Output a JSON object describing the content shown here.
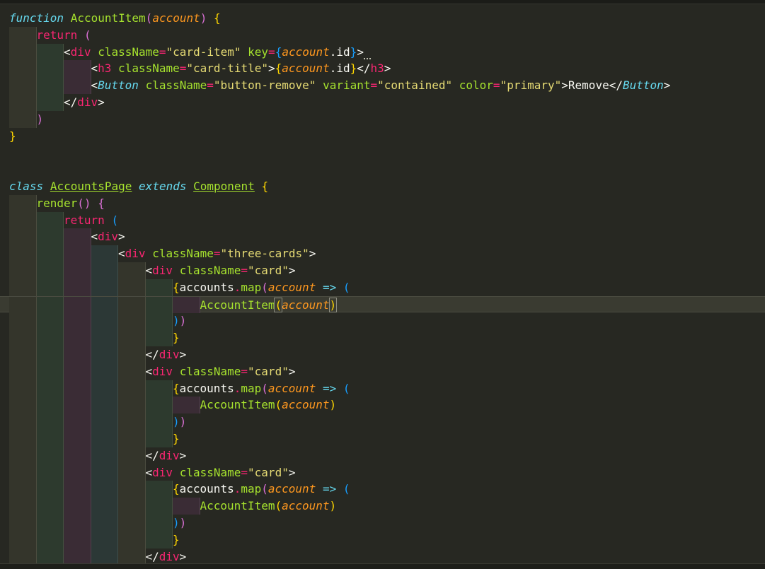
{
  "editor": {
    "lines": [
      {
        "indent": 0,
        "tokens": [
          {
            "c": "kw",
            "t": "function"
          },
          {
            "c": "plain",
            "t": " "
          },
          {
            "c": "fn",
            "t": "AccountItem"
          },
          {
            "c": "b2",
            "t": "("
          },
          {
            "c": "param",
            "t": "account"
          },
          {
            "c": "b2",
            "t": ")"
          },
          {
            "c": "plain",
            "t": " "
          },
          {
            "c": "b1",
            "t": "{"
          }
        ]
      },
      {
        "indent": 1,
        "tokens": [
          {
            "c": "ret",
            "t": "return"
          },
          {
            "c": "plain",
            "t": " "
          },
          {
            "c": "b2",
            "t": "("
          }
        ]
      },
      {
        "indent": 2,
        "tokens": [
          {
            "c": "punc",
            "t": "<"
          },
          {
            "c": "tag",
            "t": "div"
          },
          {
            "c": "plain",
            "t": " "
          },
          {
            "c": "attr",
            "t": "className"
          },
          {
            "c": "op",
            "t": "="
          },
          {
            "c": "str",
            "t": "\"card-item\""
          },
          {
            "c": "plain",
            "t": " "
          },
          {
            "c": "attr",
            "t": "key"
          },
          {
            "c": "op",
            "t": "="
          },
          {
            "c": "b3",
            "t": "{"
          },
          {
            "c": "param",
            "t": "account"
          },
          {
            "c": "plain",
            "t": ".id"
          },
          {
            "c": "b3",
            "t": "}"
          },
          {
            "c": "punc",
            "t": ">"
          }
        ]
      },
      {
        "indent": 3,
        "tokens": [
          {
            "c": "punc",
            "t": "<"
          },
          {
            "c": "tag",
            "t": "h3"
          },
          {
            "c": "plain",
            "t": " "
          },
          {
            "c": "attr",
            "t": "className"
          },
          {
            "c": "op",
            "t": "="
          },
          {
            "c": "str",
            "t": "\"card-title\""
          },
          {
            "c": "punc",
            "t": ">"
          },
          {
            "c": "b1",
            "t": "{"
          },
          {
            "c": "param",
            "t": "account"
          },
          {
            "c": "plain",
            "t": ".id"
          },
          {
            "c": "b1",
            "t": "}"
          },
          {
            "c": "punc",
            "t": "<"
          },
          {
            "c": "punc squiggle",
            "t": "/"
          },
          {
            "c": "tag",
            "t": "h3"
          },
          {
            "c": "punc",
            "t": ">"
          }
        ]
      },
      {
        "indent": 3,
        "tokens": [
          {
            "c": "punc",
            "t": "<"
          },
          {
            "c": "comp",
            "t": "Button"
          },
          {
            "c": "plain",
            "t": " "
          },
          {
            "c": "attr",
            "t": "className"
          },
          {
            "c": "op",
            "t": "="
          },
          {
            "c": "str",
            "t": "\"button-remove\""
          },
          {
            "c": "plain",
            "t": " "
          },
          {
            "c": "attr",
            "t": "variant"
          },
          {
            "c": "op",
            "t": "="
          },
          {
            "c": "str",
            "t": "\"contained\""
          },
          {
            "c": "plain",
            "t": " "
          },
          {
            "c": "attr",
            "t": "color"
          },
          {
            "c": "op",
            "t": "="
          },
          {
            "c": "str",
            "t": "\"primary\""
          },
          {
            "c": "punc",
            "t": ">"
          },
          {
            "c": "plain",
            "t": "Remove"
          },
          {
            "c": "punc",
            "t": "</"
          },
          {
            "c": "comp",
            "t": "Button"
          },
          {
            "c": "punc",
            "t": ">"
          }
        ]
      },
      {
        "indent": 2,
        "tokens": [
          {
            "c": "punc",
            "t": "</"
          },
          {
            "c": "tag",
            "t": "div"
          },
          {
            "c": "punc",
            "t": ">"
          }
        ]
      },
      {
        "indent": 1,
        "tokens": [
          {
            "c": "b2",
            "t": ")"
          }
        ]
      },
      {
        "indent": 0,
        "tokens": [
          {
            "c": "b1",
            "t": "}"
          }
        ]
      },
      {
        "indent": 0,
        "tokens": []
      },
      {
        "indent": 0,
        "tokens": []
      },
      {
        "indent": 0,
        "tokens": [
          {
            "c": "kw",
            "t": "class"
          },
          {
            "c": "plain",
            "t": " "
          },
          {
            "c": "fn ul",
            "t": "AccountsPage"
          },
          {
            "c": "plain",
            "t": " "
          },
          {
            "c": "kw",
            "t": "extends"
          },
          {
            "c": "plain",
            "t": " "
          },
          {
            "c": "fn ul",
            "t": "Component"
          },
          {
            "c": "plain",
            "t": " "
          },
          {
            "c": "b1",
            "t": "{"
          }
        ]
      },
      {
        "indent": 1,
        "tokens": [
          {
            "c": "fn",
            "t": "render"
          },
          {
            "c": "b2",
            "t": "()"
          },
          {
            "c": "plain",
            "t": " "
          },
          {
            "c": "b2",
            "t": "{"
          }
        ]
      },
      {
        "indent": 2,
        "tokens": [
          {
            "c": "ret",
            "t": "return"
          },
          {
            "c": "plain",
            "t": " "
          },
          {
            "c": "b3",
            "t": "("
          }
        ]
      },
      {
        "indent": 3,
        "tokens": [
          {
            "c": "punc",
            "t": "<"
          },
          {
            "c": "tag",
            "t": "div"
          },
          {
            "c": "punc",
            "t": ">"
          }
        ]
      },
      {
        "indent": 4,
        "tokens": [
          {
            "c": "punc",
            "t": "<"
          },
          {
            "c": "tag",
            "t": "div"
          },
          {
            "c": "plain",
            "t": " "
          },
          {
            "c": "attr",
            "t": "className"
          },
          {
            "c": "op",
            "t": "="
          },
          {
            "c": "str",
            "t": "\"three-cards\""
          },
          {
            "c": "punc",
            "t": ">"
          }
        ]
      },
      {
        "indent": 5,
        "tokens": [
          {
            "c": "punc",
            "t": "<"
          },
          {
            "c": "tag",
            "t": "div"
          },
          {
            "c": "plain",
            "t": " "
          },
          {
            "c": "attr",
            "t": "className"
          },
          {
            "c": "op",
            "t": "="
          },
          {
            "c": "str",
            "t": "\"card\""
          },
          {
            "c": "punc",
            "t": ">"
          }
        ]
      },
      {
        "indent": 6,
        "tokens": [
          {
            "c": "b1",
            "t": "{"
          },
          {
            "c": "plain",
            "t": "accounts"
          },
          {
            "c": "op",
            "t": "."
          },
          {
            "c": "fn",
            "t": "map"
          },
          {
            "c": "b2",
            "t": "("
          },
          {
            "c": "param",
            "t": "account"
          },
          {
            "c": "plain",
            "t": " "
          },
          {
            "c": "kw",
            "t": "=>"
          },
          {
            "c": "plain",
            "t": " "
          },
          {
            "c": "b3",
            "t": "("
          }
        ]
      },
      {
        "indent": 7,
        "current": true,
        "tokens": [
          {
            "c": "fn",
            "t": "AccountItem"
          },
          {
            "c": "b1 bracket-match",
            "t": "("
          },
          {
            "c": "param",
            "t": "account"
          },
          {
            "c": "b1 bracket-match",
            "t": ")"
          }
        ]
      },
      {
        "indent": 6,
        "tokens": [
          {
            "c": "b3",
            "t": ")"
          },
          {
            "c": "b2",
            "t": ")"
          }
        ]
      },
      {
        "indent": 6,
        "tokens": [
          {
            "c": "b1",
            "t": "}"
          }
        ]
      },
      {
        "indent": 5,
        "tokens": [
          {
            "c": "punc",
            "t": "</"
          },
          {
            "c": "tag",
            "t": "div"
          },
          {
            "c": "punc",
            "t": ">"
          }
        ]
      },
      {
        "indent": 5,
        "tokens": [
          {
            "c": "punc",
            "t": "<"
          },
          {
            "c": "tag",
            "t": "div"
          },
          {
            "c": "plain",
            "t": " "
          },
          {
            "c": "attr",
            "t": "className"
          },
          {
            "c": "op",
            "t": "="
          },
          {
            "c": "str",
            "t": "\"card\""
          },
          {
            "c": "punc",
            "t": ">"
          }
        ]
      },
      {
        "indent": 6,
        "tokens": [
          {
            "c": "b1",
            "t": "{"
          },
          {
            "c": "plain",
            "t": "accounts"
          },
          {
            "c": "op",
            "t": "."
          },
          {
            "c": "fn",
            "t": "map"
          },
          {
            "c": "b2",
            "t": "("
          },
          {
            "c": "param",
            "t": "account"
          },
          {
            "c": "plain",
            "t": " "
          },
          {
            "c": "kw",
            "t": "=>"
          },
          {
            "c": "plain",
            "t": " "
          },
          {
            "c": "b3",
            "t": "("
          }
        ]
      },
      {
        "indent": 7,
        "tokens": [
          {
            "c": "fn",
            "t": "AccountItem"
          },
          {
            "c": "b1",
            "t": "("
          },
          {
            "c": "param",
            "t": "account"
          },
          {
            "c": "b1",
            "t": ")"
          }
        ]
      },
      {
        "indent": 6,
        "tokens": [
          {
            "c": "b3",
            "t": ")"
          },
          {
            "c": "b2",
            "t": ")"
          }
        ]
      },
      {
        "indent": 6,
        "tokens": [
          {
            "c": "b1",
            "t": "}"
          }
        ]
      },
      {
        "indent": 5,
        "tokens": [
          {
            "c": "punc",
            "t": "</"
          },
          {
            "c": "tag",
            "t": "div"
          },
          {
            "c": "punc",
            "t": ">"
          }
        ]
      },
      {
        "indent": 5,
        "tokens": [
          {
            "c": "punc",
            "t": "<"
          },
          {
            "c": "tag",
            "t": "div"
          },
          {
            "c": "plain",
            "t": " "
          },
          {
            "c": "attr",
            "t": "className"
          },
          {
            "c": "op",
            "t": "="
          },
          {
            "c": "str",
            "t": "\"card\""
          },
          {
            "c": "punc",
            "t": ">"
          }
        ]
      },
      {
        "indent": 6,
        "tokens": [
          {
            "c": "b1",
            "t": "{"
          },
          {
            "c": "plain",
            "t": "accounts"
          },
          {
            "c": "op",
            "t": "."
          },
          {
            "c": "fn",
            "t": "map"
          },
          {
            "c": "b2",
            "t": "("
          },
          {
            "c": "param",
            "t": "account"
          },
          {
            "c": "plain",
            "t": " "
          },
          {
            "c": "kw",
            "t": "=>"
          },
          {
            "c": "plain",
            "t": " "
          },
          {
            "c": "b3",
            "t": "("
          }
        ]
      },
      {
        "indent": 7,
        "tokens": [
          {
            "c": "fn",
            "t": "AccountItem"
          },
          {
            "c": "b1",
            "t": "("
          },
          {
            "c": "param",
            "t": "account"
          },
          {
            "c": "b1",
            "t": ")"
          }
        ]
      },
      {
        "indent": 6,
        "tokens": [
          {
            "c": "b3",
            "t": ")"
          },
          {
            "c": "b2",
            "t": ")"
          }
        ]
      },
      {
        "indent": 6,
        "tokens": [
          {
            "c": "b1",
            "t": "}"
          }
        ]
      },
      {
        "indent": 5,
        "tokens": [
          {
            "c": "punc",
            "t": "</"
          },
          {
            "c": "tag",
            "t": "div"
          },
          {
            "c": "punc",
            "t": ">"
          }
        ]
      }
    ]
  }
}
